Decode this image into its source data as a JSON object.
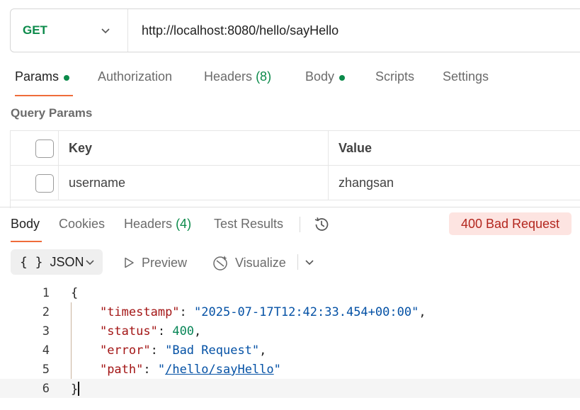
{
  "request": {
    "method": "GET",
    "url": "http://localhost:8080/hello/sayHello"
  },
  "request_tabs": {
    "params": "Params",
    "authorization": "Authorization",
    "headers": "Headers",
    "headers_count": "(8)",
    "body": "Body",
    "scripts": "Scripts",
    "settings": "Settings"
  },
  "query_params": {
    "title": "Query Params",
    "columns": {
      "key": "Key",
      "value": "Value"
    },
    "rows": [
      {
        "key": "username",
        "value": "zhangsan",
        "checked": false
      }
    ]
  },
  "response_tabs": {
    "body": "Body",
    "cookies": "Cookies",
    "headers": "Headers",
    "headers_count": "(4)",
    "test_results": "Test Results"
  },
  "response": {
    "status": "400 Bad Request",
    "format": "JSON",
    "preview_label": "Preview",
    "visualize_label": "Visualize"
  },
  "body_json": {
    "line_numbers": [
      "1",
      "2",
      "3",
      "4",
      "5",
      "6"
    ],
    "open_brace": "{",
    "close_brace": "}",
    "fields": [
      {
        "key": "\"timestamp\"",
        "value": "\"2025-07-17T12:42:33.454+00:00\""
      },
      {
        "key": "\"status\"",
        "value": "400"
      },
      {
        "key": "\"error\"",
        "value": "\"Bad Request\""
      },
      {
        "key": "\"path\"",
        "value_prefix": "\"",
        "link": "/hello/sayHello",
        "value_suffix": "\""
      }
    ]
  },
  "colors": {
    "method_get": "#0b8a4a",
    "active_tab_underline": "#ef6c3a",
    "status_error_bg": "#fde4e1",
    "status_error_text": "#b3261e"
  }
}
